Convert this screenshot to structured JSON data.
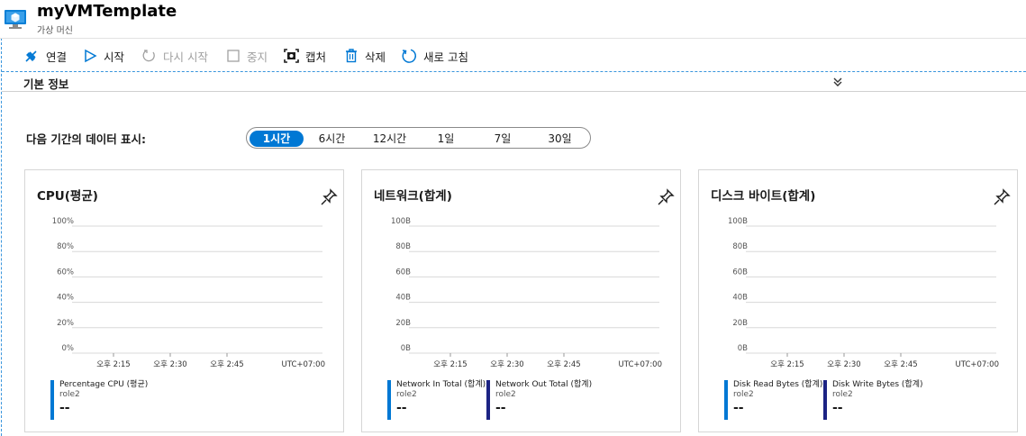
{
  "header": {
    "title": "myVMTemplate",
    "subtitle": "가상 머신"
  },
  "toolbar": {
    "connect": "연결",
    "start": "시작",
    "restart": "다시 시작",
    "stop": "중지",
    "capture": "캡처",
    "delete": "삭제",
    "refresh": "새로 고침"
  },
  "essentials": {
    "label": "기본 정보",
    "chevron": "»"
  },
  "time_range": {
    "label": "다음 기간의 데이터 표시:",
    "options": [
      "1시간",
      "6시간",
      "12시간",
      "1일",
      "7일",
      "30일"
    ],
    "selected": "1시간"
  },
  "colors": {
    "accent": "#0078d4",
    "series_light": "#0078d4",
    "series_dark": "#1c2384",
    "dashed": "#3a96dd"
  },
  "chart_data": [
    {
      "type": "line",
      "title": "CPU(평균)",
      "y_ticks": [
        "100%",
        "80%",
        "60%",
        "40%",
        "20%",
        "0%"
      ],
      "x_ticks": [
        "오후 2:15",
        "오후 2:30",
        "오후 2:45"
      ],
      "timezone": "UTC+07:00",
      "grid": true,
      "series": [
        {
          "name": "Percentage CPU (평균)",
          "sub": "role2",
          "value": "--"
        }
      ]
    },
    {
      "type": "line",
      "title": "네트워크(합계)",
      "y_ticks": [
        "100B",
        "80B",
        "60B",
        "40B",
        "20B",
        "0B"
      ],
      "x_ticks": [
        "오후 2:15",
        "오후 2:30",
        "오후 2:45"
      ],
      "timezone": "UTC+07:00",
      "grid": true,
      "series": [
        {
          "name": "Network In Total (합계)",
          "sub": "role2",
          "value": "--"
        },
        {
          "name": "Network Out Total (합계)",
          "sub": "role2",
          "value": "--"
        }
      ]
    },
    {
      "type": "line",
      "title": "디스크 바이트(합계)",
      "y_ticks": [
        "100B",
        "80B",
        "60B",
        "40B",
        "20B",
        "0B"
      ],
      "x_ticks": [
        "오후 2:15",
        "오후 2:30",
        "오후 2:45"
      ],
      "timezone": "UTC+07:00",
      "grid": true,
      "series": [
        {
          "name": "Disk Read Bytes (합계)",
          "sub": "role2",
          "value": "--"
        },
        {
          "name": "Disk Write Bytes (합계)",
          "sub": "role2",
          "value": "--"
        }
      ]
    }
  ]
}
